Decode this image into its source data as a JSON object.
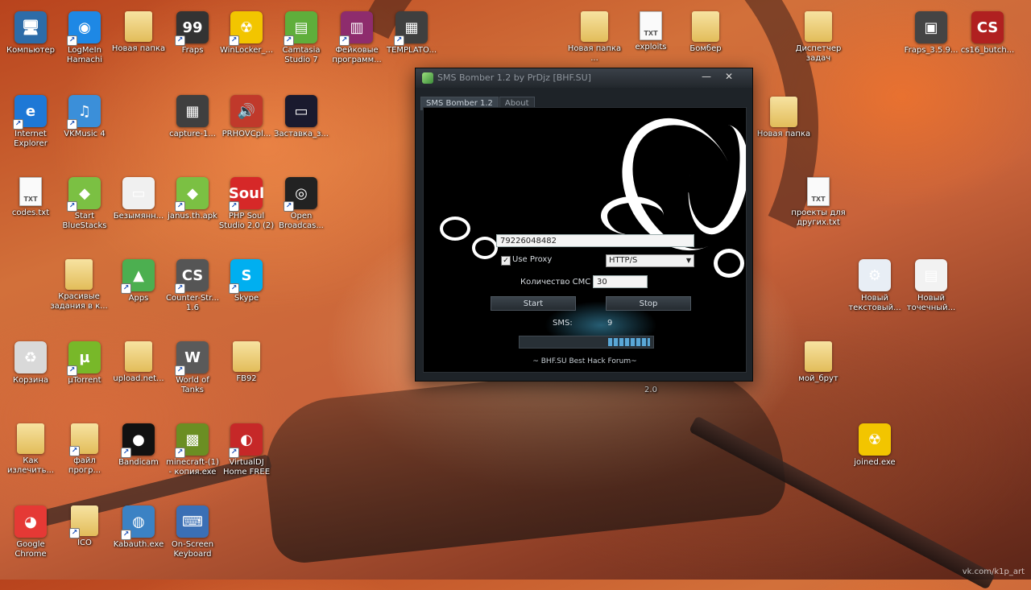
{
  "desktop": {
    "icons": [
      {
        "label": "Компьютер",
        "glyph": "🖥",
        "color": "#2d6ca8"
      },
      {
        "label": "LogMeIn\nHamachi",
        "glyph": "◉",
        "color": "#1e88e5"
      },
      {
        "label": "Новая папка",
        "glyph": "",
        "color": "folder"
      },
      {
        "label": "Fraps",
        "glyph": "99",
        "color": "#333333"
      },
      {
        "label": "WinLocker_...",
        "glyph": "☢",
        "color": "#f2c500"
      },
      {
        "label": "Camtasia\nStudio 7",
        "glyph": "▤",
        "color": "#5fae3b"
      },
      {
        "label": "Фейковые\nпрограмм...",
        "glyph": "▥",
        "color": "#8e2c6d"
      },
      {
        "label": "TEMPLATO...",
        "glyph": "▦",
        "color": "#3f3f3f"
      },
      {
        "label": "Новая папка\n...",
        "glyph": "",
        "color": "folder"
      },
      {
        "label": "exploits",
        "glyph": "TXT",
        "color": "txt"
      },
      {
        "label": "Бомбер",
        "glyph": "",
        "color": "folder"
      },
      {
        "label": "Диспетчер\nзадач",
        "glyph": "",
        "color": "folder"
      },
      {
        "label": "Fraps_3.5.9...",
        "glyph": "▣",
        "color": "#444"
      },
      {
        "label": "cs16_butch...",
        "glyph": "CS",
        "color": "#b02020"
      },
      {
        "label": "Internet\nExplorer",
        "glyph": "e",
        "color": "#1e78d6"
      },
      {
        "label": "VKMusic 4",
        "glyph": "♫",
        "color": "#3b8fd9"
      },
      {
        "label": "capture-1...",
        "glyph": "▦",
        "color": "#3f3f3f"
      },
      {
        "label": "PRHOVCpl...",
        "glyph": "🔊",
        "color": "#c0392b"
      },
      {
        "label": "Заставка_з...",
        "glyph": "▭",
        "color": "#1a1a2e"
      },
      {
        "label": "codes.txt",
        "glyph": "TXT",
        "color": "txt"
      },
      {
        "label": "Start\nBlueStacks",
        "glyph": "◆",
        "color": "#7bc043"
      },
      {
        "label": "Безымянн...",
        "glyph": "▭",
        "color": "#f0f0f0"
      },
      {
        "label": "janus.th.apk",
        "glyph": "◆",
        "color": "#7bc043"
      },
      {
        "label": "PHP Soul\nStudio 2.0 (2)",
        "glyph": "Soul",
        "color": "#d62828"
      },
      {
        "label": "Open\nBroadcas...",
        "glyph": "◎",
        "color": "#222"
      },
      {
        "label": "проекты для\nдругих.txt",
        "glyph": "TXT",
        "color": "txt"
      },
      {
        "label": "Красивые\nзадания в к...",
        "glyph": "",
        "color": "folder"
      },
      {
        "label": "Apps",
        "glyph": "▲",
        "color": "#4caf50"
      },
      {
        "label": "Counter-Str...\n1.6",
        "glyph": "CS",
        "color": "#555"
      },
      {
        "label": "Skype",
        "glyph": "S",
        "color": "#00aff0"
      },
      {
        "label": "Новый\nтекстовый...",
        "glyph": "⚙",
        "color": "#e8eef5"
      },
      {
        "label": "Новый\nточечный...",
        "glyph": "▤",
        "color": "#f2f2f2"
      },
      {
        "label": "Корзина",
        "glyph": "♻",
        "color": "#d9d9d9"
      },
      {
        "label": "µTorrent",
        "glyph": "µ",
        "color": "#78b829"
      },
      {
        "label": "upload.net...",
        "glyph": "",
        "color": "folder"
      },
      {
        "label": "World of\nTanks",
        "glyph": "W",
        "color": "#5a5a5a"
      },
      {
        "label": "FB92",
        "glyph": "",
        "color": "folder"
      },
      {
        "label": "мой_брут",
        "glyph": "",
        "color": "folder"
      },
      {
        "label": "Как\nизлечить...",
        "glyph": "",
        "color": "folder"
      },
      {
        "label": "файл\nпрогр...",
        "glyph": "",
        "color": "folder"
      },
      {
        "label": "Bandicam",
        "glyph": "●",
        "color": "#111"
      },
      {
        "label": "minecraft-(1)\n- копия.exe",
        "glyph": "▩",
        "color": "#6b8e23"
      },
      {
        "label": "VirtualDJ\nHome FREE",
        "glyph": "◐",
        "color": "#c62828"
      },
      {
        "label": "joined.exe",
        "glyph": "☢",
        "color": "#f2c500"
      },
      {
        "label": "Google\nChrome",
        "glyph": "◕",
        "color": "#e53935"
      },
      {
        "label": "ICO",
        "glyph": "",
        "color": "folder"
      },
      {
        "label": "Kabauth.exe",
        "glyph": "◍",
        "color": "#3b82c4"
      },
      {
        "label": "On-Screen\nKeyboard",
        "glyph": "⌨",
        "color": "#3a6fb5"
      },
      {
        "label": "Новая папка",
        "glyph": "",
        "color": "folder"
      },
      {
        "label": "2.0",
        "glyph": "",
        "color": "none"
      }
    ],
    "watermark": "vk.com/k1p_art"
  },
  "window": {
    "title": "SMS Bomber 1.2 by PrDjz [BHF.SU]",
    "tabs": [
      "SMS Bomber 1.2",
      "About"
    ],
    "phone_value": "79226048482",
    "proxy_label": "Use Proxy",
    "proxy_checked": true,
    "proxy_type": "HTTP/S",
    "count_label": "Количество СМС",
    "count_value": "30",
    "start_label": "Start",
    "stop_label": "Stop",
    "sms_label": "SMS:",
    "sms_count": "9",
    "footer": "~ BHF.SU  Best Hack Forum~"
  }
}
